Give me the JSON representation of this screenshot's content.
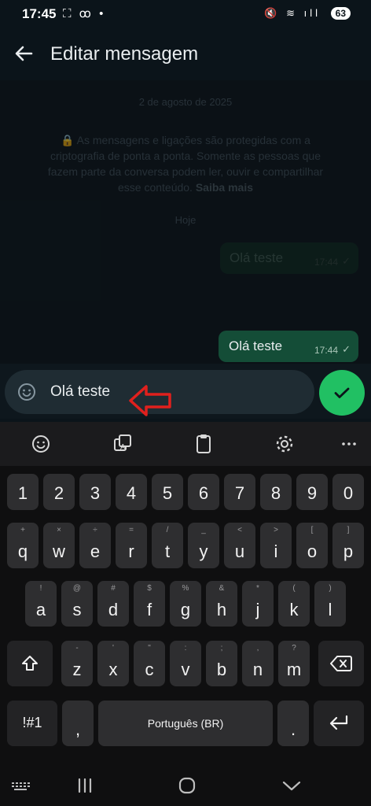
{
  "status_bar": {
    "time": "17:45",
    "left_icons": "⛶ ꝏ •",
    "right_icons": "🔇 ≋ ıll",
    "battery": "63"
  },
  "header": {
    "title": "Editar mensagem"
  },
  "chat": {
    "date_label": "2 de agosto de 2025",
    "encryption_text": "As mensagens e ligações são protegidas com a criptografia de ponta a ponta. Somente as pessoas que fazem parte da conversa podem ler, ouvir e compartilhar esse conteúdo.",
    "encryption_link": "Saiba mais",
    "today_label": "Hoje",
    "messages": [
      {
        "text": "Olá teste",
        "time": "17:44",
        "status": "✓"
      },
      {
        "text": "Olá teste",
        "time": "17:44",
        "status": "✓"
      }
    ]
  },
  "composer": {
    "value": "Olá teste"
  },
  "keyboard": {
    "toolbar": [
      "emoji",
      "translate",
      "clipboard",
      "settings",
      "more"
    ],
    "number_row": [
      "1",
      "2",
      "3",
      "4",
      "5",
      "6",
      "7",
      "8",
      "9",
      "0"
    ],
    "row1": [
      "q",
      "w",
      "e",
      "r",
      "t",
      "y",
      "u",
      "i",
      "o",
      "p"
    ],
    "row1_hints": [
      "+",
      "×",
      "÷",
      "=",
      "/",
      "_",
      "<",
      ">",
      "[",
      "]"
    ],
    "row2": [
      "a",
      "s",
      "d",
      "f",
      "g",
      "h",
      "j",
      "k",
      "l"
    ],
    "row2_hints": [
      "!",
      "@",
      "#",
      "$",
      "%",
      "&",
      "*",
      "(",
      ")"
    ],
    "row3": [
      "z",
      "x",
      "c",
      "v",
      "b",
      "n",
      "m"
    ],
    "row3_hints": [
      "-",
      "'",
      "\"",
      ":",
      ";",
      ",",
      "?"
    ],
    "symbols_label": "!#1",
    "comma": ",",
    "space_label": "Português (BR)",
    "period": "."
  },
  "colors": {
    "accent": "#21c063",
    "bubble_out": "#144d37",
    "annotation": "#e0201d"
  }
}
